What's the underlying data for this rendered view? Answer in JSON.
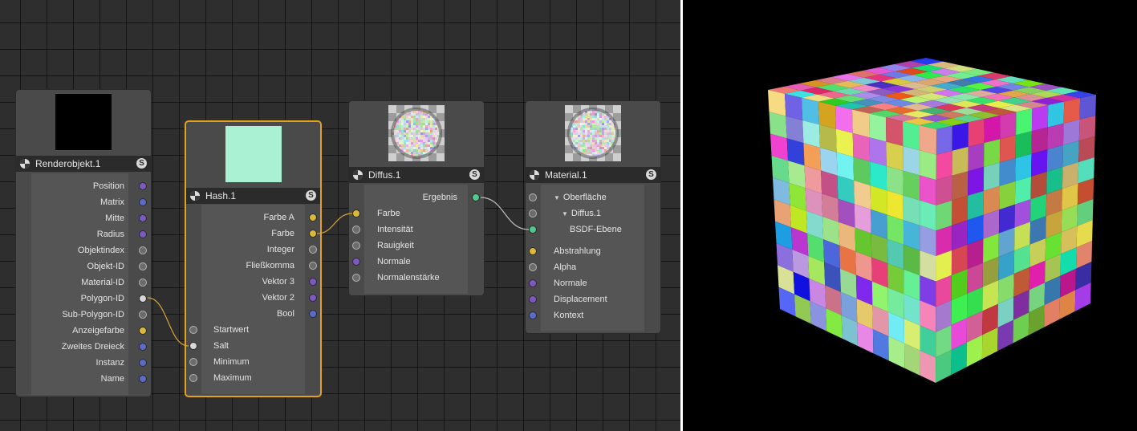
{
  "nodes": {
    "renderobjekt": {
      "title": "Renderobjekt.1",
      "solo": "S",
      "preview_color": "#000000",
      "outputs": [
        {
          "label": "Position",
          "color": "purple"
        },
        {
          "label": "Matrix",
          "color": "blue"
        },
        {
          "label": "Mitte",
          "color": "purple"
        },
        {
          "label": "Radius",
          "color": "purple"
        },
        {
          "label": "Objektindex",
          "color": "gray"
        },
        {
          "label": "Objekt-ID",
          "color": "gray"
        },
        {
          "label": "Material-ID",
          "color": "gray"
        },
        {
          "label": "Polygon-ID",
          "color": "white"
        },
        {
          "label": "Sub-Polygon-ID",
          "color": "gray"
        },
        {
          "label": "Anzeigefarbe",
          "color": "yellow"
        },
        {
          "label": "Zweites Dreieck",
          "color": "blue"
        },
        {
          "label": "Instanz",
          "color": "blue"
        },
        {
          "label": "Name",
          "color": "blue"
        }
      ]
    },
    "hash": {
      "title": "Hash.1",
      "solo": "S",
      "preview_color": "#aaf0d2",
      "outputs": [
        {
          "label": "Farbe A",
          "color": "yellow"
        },
        {
          "label": "Farbe",
          "color": "yellow"
        },
        {
          "label": "Integer",
          "color": "gray"
        },
        {
          "label": "Fließkomma",
          "color": "gray"
        },
        {
          "label": "Vektor 3",
          "color": "purple"
        },
        {
          "label": "Vektor 2",
          "color": "purple"
        },
        {
          "label": "Bool",
          "color": "blue"
        }
      ],
      "inputs": [
        {
          "label": "Startwert",
          "color": "gray"
        },
        {
          "label": "Salt",
          "color": "white"
        },
        {
          "label": "Minimum",
          "color": "gray"
        },
        {
          "label": "Maximum",
          "color": "gray"
        }
      ]
    },
    "diffus": {
      "title": "Diffus.1",
      "solo": "S",
      "outputs": [
        {
          "label": "Ergebnis",
          "color": "green"
        }
      ],
      "inputs": [
        {
          "label": "Farbe",
          "color": "yellow"
        },
        {
          "label": "Intensität",
          "color": "gray"
        },
        {
          "label": "Rauigkeit",
          "color": "gray"
        },
        {
          "label": "Normale",
          "color": "purple"
        },
        {
          "label": "Normalenstärke",
          "color": "gray"
        }
      ]
    },
    "material": {
      "title": "Material.1",
      "solo": "S",
      "inputs": [
        {
          "label": "Oberfläche",
          "color": "gray",
          "indent": 0,
          "triangle": true
        },
        {
          "label": "Diffus.1",
          "color": "gray",
          "indent": 1,
          "triangle": true
        },
        {
          "label": "BSDF-Ebene",
          "color": "green",
          "indent": 2,
          "triangle": false
        },
        {
          "label": "Abstrahlung",
          "color": "yellow",
          "indent": 0,
          "triangle": false
        },
        {
          "label": "Alpha",
          "color": "gray",
          "indent": 0,
          "triangle": false
        },
        {
          "label": "Normale",
          "color": "purple",
          "indent": 0,
          "triangle": false
        },
        {
          "label": "Displacement",
          "color": "purple",
          "indent": 0,
          "triangle": false
        },
        {
          "label": "Kontext",
          "color": "blue",
          "indent": 0,
          "triangle": false
        }
      ]
    }
  },
  "colors": {
    "selected_border": "#e4a21a",
    "wire_yellow": "#d6a33a",
    "wire_gray": "#bdbdbd",
    "viewport_bg": "#000000"
  },
  "cube": {
    "grid": 10
  }
}
